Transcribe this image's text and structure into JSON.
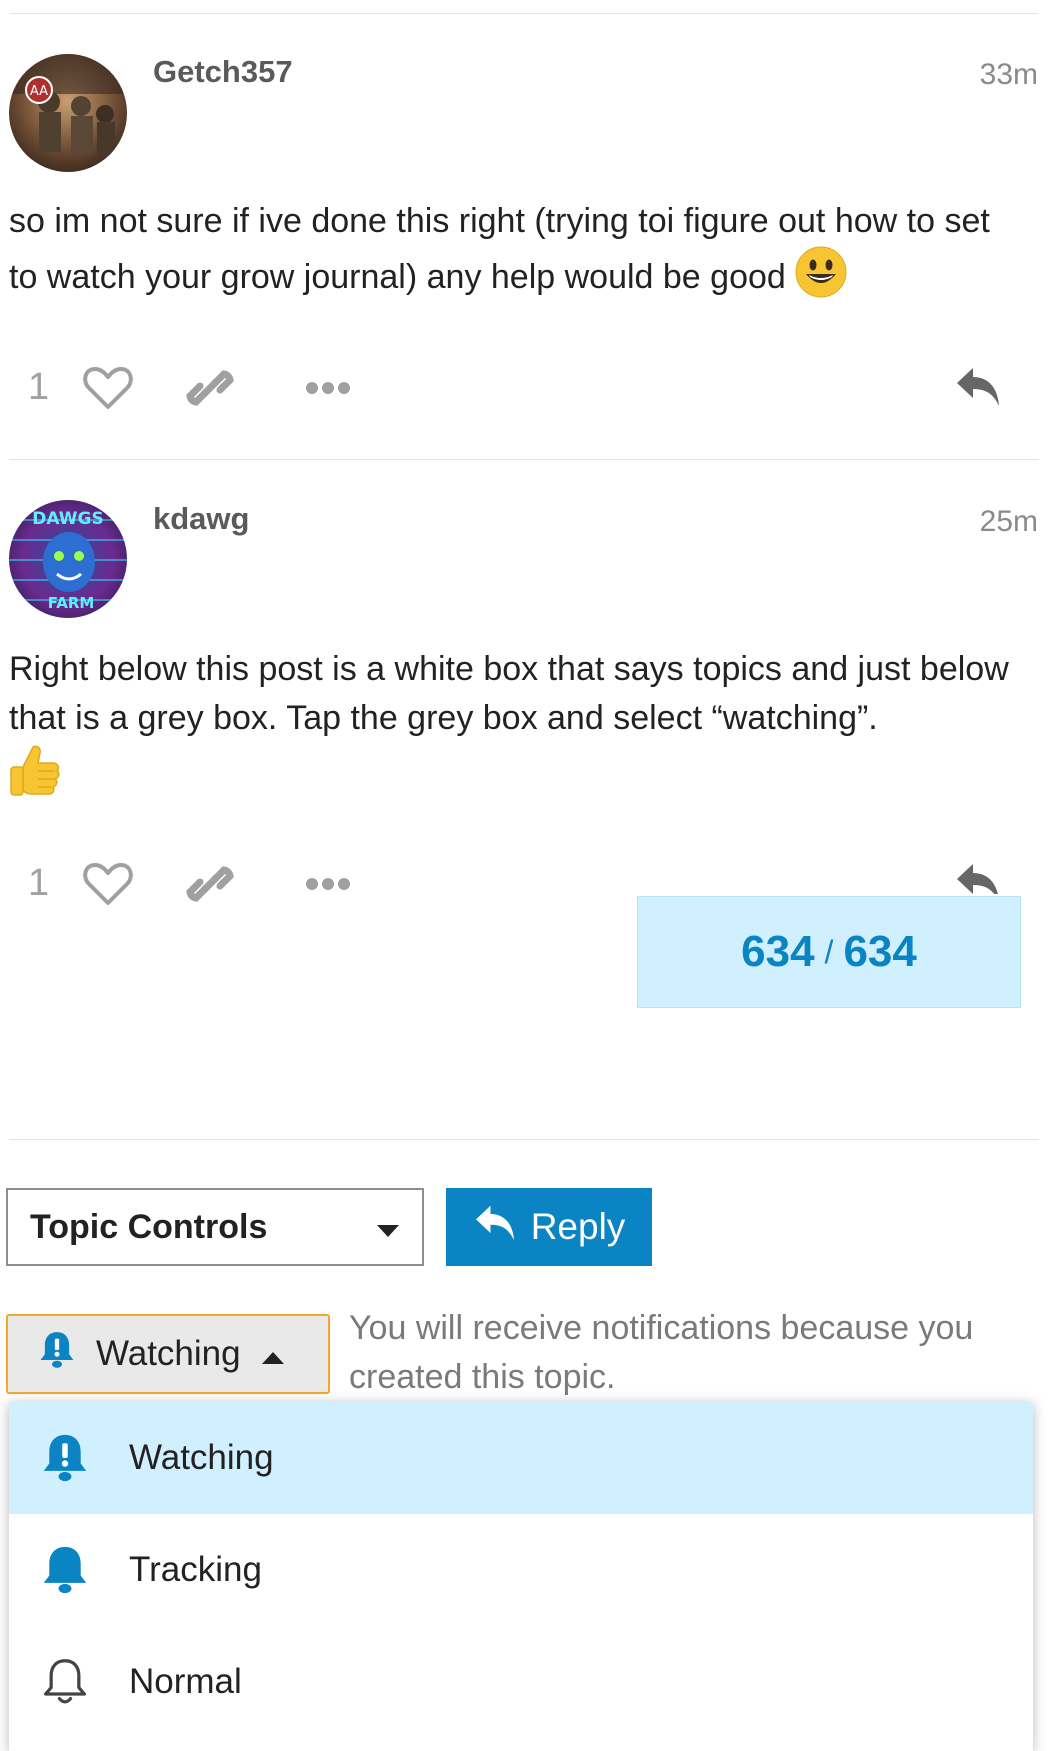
{
  "posts": [
    {
      "username": "Getch357",
      "time": "33m",
      "body": "so im not sure if ive done this right (trying toi figure out how to set to watch your grow journal) any help would be good",
      "emoji": "smiley",
      "like_count": "1"
    },
    {
      "username": "kdawg",
      "time": "25m",
      "body": "Right below this post is a white box that says topics and just below that is a grey box. Tap the grey box and select “watching”.",
      "emoji": "thumbs-up",
      "like_count": "1"
    }
  ],
  "progress": {
    "current": "634",
    "separator": "/",
    "total": "634"
  },
  "topic_controls": {
    "label": "Topic Controls"
  },
  "reply_button": {
    "label": "Reply"
  },
  "notification": {
    "current_level": "Watching",
    "reason": "You will receive notifications because you created this topic.",
    "options": [
      {
        "label": "Watching",
        "icon": "bell-exclamation-icon",
        "selected": true
      },
      {
        "label": "Tracking",
        "icon": "bell-filled-icon",
        "selected": false
      },
      {
        "label": "Normal",
        "icon": "bell-outline-icon",
        "selected": false
      }
    ]
  },
  "colors": {
    "accent": "#0a84c2",
    "highlight": "#d1f0ff",
    "focus_border": "#f0a830",
    "icon_grey": "#9a9a9a"
  }
}
